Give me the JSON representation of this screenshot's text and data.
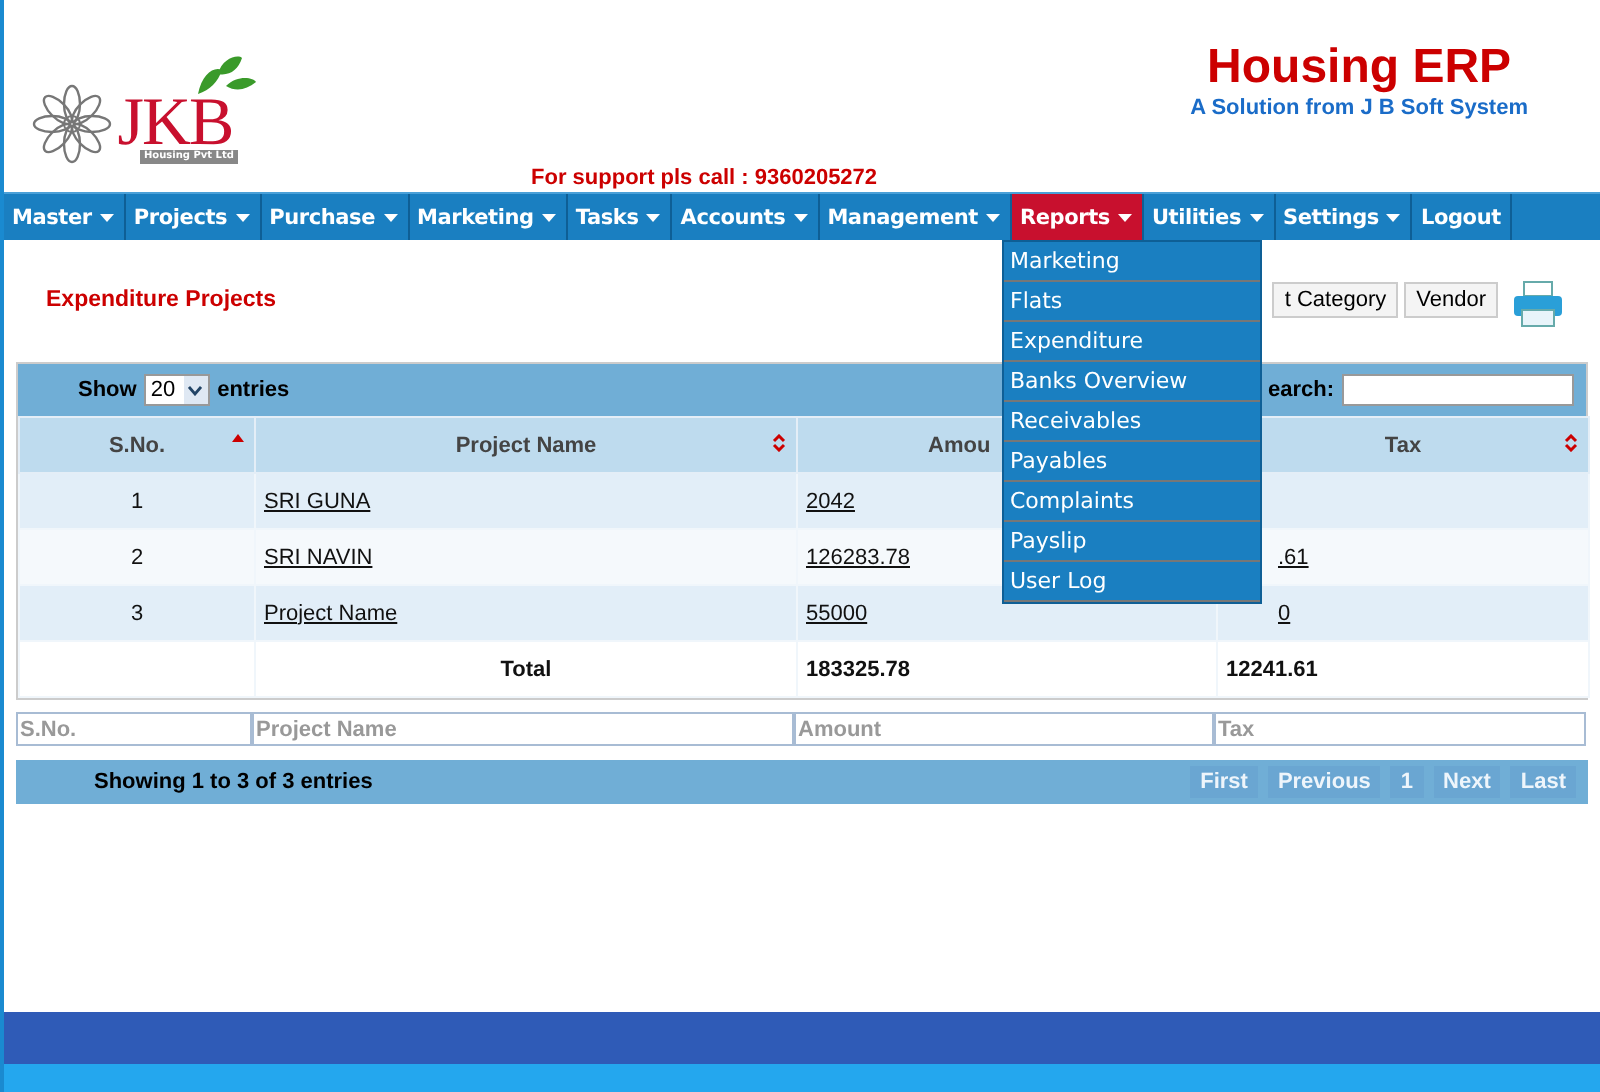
{
  "header": {
    "logo": {
      "name": "JKB",
      "tagline": "Housing Pvt Ltd"
    },
    "title": "Housing ERP",
    "subtitle": "A Solution from J B Soft System",
    "support": "For support pls call : 9360205272"
  },
  "nav": [
    {
      "label": "Master",
      "dropdown": true,
      "selected": false
    },
    {
      "label": "Projects",
      "dropdown": true,
      "selected": false
    },
    {
      "label": "Purchase",
      "dropdown": true,
      "selected": false
    },
    {
      "label": "Marketing",
      "dropdown": true,
      "selected": false
    },
    {
      "label": "Tasks",
      "dropdown": true,
      "selected": false
    },
    {
      "label": "Accounts",
      "dropdown": true,
      "selected": false
    },
    {
      "label": "Management",
      "dropdown": true,
      "selected": false
    },
    {
      "label": "Reports",
      "dropdown": true,
      "selected": true
    },
    {
      "label": "Utilities",
      "dropdown": true,
      "selected": false
    },
    {
      "label": "Settings",
      "dropdown": true,
      "selected": false
    },
    {
      "label": "Logout",
      "dropdown": false,
      "selected": false
    }
  ],
  "open_menu": [
    "Marketing",
    "Flats",
    "Expenditure",
    "Banks Overview",
    "Receivables",
    "Payables",
    "Complaints",
    "Payslip",
    "User Log"
  ],
  "page_title": "Expenditure Projects",
  "toolbar": {
    "buttons": [
      "t Category",
      "Vendor"
    ]
  },
  "table": {
    "show_label": "Show",
    "page_size": "20",
    "entries_label": "entries",
    "search_label": "earch:",
    "columns": [
      {
        "label": "S.No.",
        "sorted": true
      },
      {
        "label": "Project Name",
        "sorted": false
      },
      {
        "label": "Amou"
      },
      {
        "label": "Tax",
        "sorted": false
      }
    ],
    "rows": [
      {
        "sno": "1",
        "project": "SRI GUNA",
        "amount": "2042"
      },
      {
        "sno": "2",
        "project": "SRI NAVIN",
        "amount": "126283.78",
        "tax": ".61"
      },
      {
        "sno": "3",
        "project": "Project Name",
        "amount": "55000",
        "tax": "0"
      }
    ],
    "total": {
      "label": "Total",
      "amount": "183325.78",
      "tax": "12241.61"
    },
    "filters": [
      {
        "placeholder": "S.No."
      },
      {
        "placeholder": "Project Name"
      },
      {
        "placeholder": "Amount"
      },
      {
        "placeholder": "Tax"
      }
    ],
    "info": "Showing 1 to 3 of 3 entries",
    "pagination": [
      {
        "label": "First",
        "disabled": true
      },
      {
        "label": "Previous",
        "disabled": true
      },
      {
        "label": "1",
        "disabled": true
      },
      {
        "label": "Next",
        "disabled": true
      },
      {
        "label": "Last",
        "disabled": true
      }
    ]
  }
}
